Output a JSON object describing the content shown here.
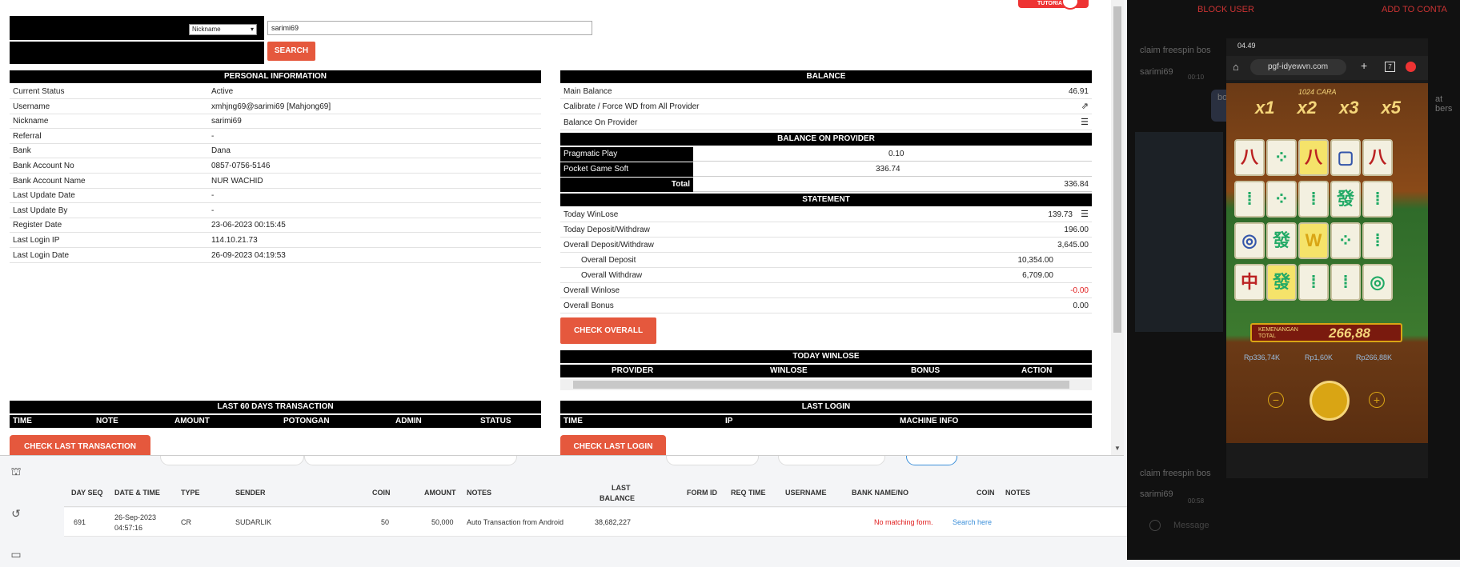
{
  "search": {
    "field_option": "Nickname",
    "value": "sarimi69",
    "button": "SEARCH"
  },
  "tutorials_label": "TUTORIALS",
  "personal": {
    "title": "PERSONAL INFORMATION",
    "rows": [
      {
        "k": "Current Status",
        "v": "Active"
      },
      {
        "k": "Username",
        "v": "xmhjng69@sarimi69  [Mahjong69]"
      },
      {
        "k": "Nickname",
        "v": "sarimi69"
      },
      {
        "k": "Referral",
        "v": "-"
      },
      {
        "k": "Bank",
        "v": "Dana"
      },
      {
        "k": "Bank Account No",
        "v": "0857-0756-5146"
      },
      {
        "k": "Bank Account Name",
        "v": "NUR WACHID"
      },
      {
        "k": "Last Update Date",
        "v": "-"
      },
      {
        "k": "Last Update By",
        "v": "-"
      },
      {
        "k": "Register Date",
        "v": "23-06-2023 00:15:45"
      },
      {
        "k": "Last Login IP",
        "v": "114.10.21.73"
      },
      {
        "k": "Last Login Date",
        "v": "26-09-2023 04:19:53"
      }
    ]
  },
  "balance": {
    "title": "BALANCE",
    "main_label": "Main Balance",
    "main_value": "46.91",
    "calibrate_label": "Calibrate / Force WD from All Provider",
    "on_provider_label": "Balance On Provider",
    "on_provider_title": "BALANCE ON PROVIDER",
    "providers": [
      {
        "name": "Pragmatic Play",
        "value": "0.10"
      },
      {
        "name": "Pocket Game Soft",
        "value": "336.74"
      }
    ],
    "total_label": "Total",
    "total_value": "336.84"
  },
  "statement": {
    "title": "STATEMENT",
    "today_winlose_label": "Today WinLose",
    "today_winlose": "139.73",
    "today_dw_label": "Today Deposit/Withdraw",
    "today_dw": "196.00",
    "overall_dw_label": "Overall Deposit/Withdraw",
    "overall_dw": "3,645.00",
    "overall_deposit_label": "Overall Deposit",
    "overall_deposit": "10,354.00",
    "overall_withdraw_label": "Overall Withdraw",
    "overall_withdraw": "6,709.00",
    "overall_winlose_label": "Overall Winlose",
    "overall_winlose": "-0.00",
    "overall_bonus_label": "Overall Bonus",
    "overall_bonus": "0.00",
    "check_button": "CHECK OVERALL"
  },
  "today_winlose": {
    "title": "TODAY WINLOSE",
    "cols": [
      "PROVIDER",
      "WINLOSE",
      "BONUS",
      "ACTION"
    ]
  },
  "last60": {
    "title": "LAST 60 DAYS TRANSACTION",
    "cols": [
      "TIME",
      "NOTE",
      "AMOUNT",
      "POTONGAN",
      "ADMIN",
      "STATUS"
    ],
    "button": "CHECK LAST TRANSACTION"
  },
  "last_login": {
    "title": "LAST LOGIN",
    "cols": [
      "TIME",
      "IP",
      "MACHINE INFO"
    ],
    "button": "CHECK LAST LOGIN"
  },
  "bg_table": {
    "headers": [
      "DAY SEQ",
      "DATE & TIME",
      "TYPE",
      "SENDER",
      "COIN",
      "AMOUNT",
      "NOTES",
      "LAST",
      "BALANCE",
      "FORM ID",
      "REQ TIME",
      "USERNAME",
      "BANK NAME/NO",
      "COIN",
      "NOTES"
    ],
    "row": {
      "seq": "691",
      "date": "26-Sep-2023",
      "time": "04:57:16",
      "type": "CR",
      "sender": "SUDARLIK",
      "coin": "50",
      "amount": "50,000",
      "notes": "Auto Transaction from Android",
      "balance": "38,682,227"
    },
    "no_match": "No matching form.",
    "search_here": "Search here"
  },
  "chat": {
    "block_user": "BLOCK USER",
    "add_contact": "ADD TO CONTA",
    "msg1": "claim freespin bos",
    "user1": "sarimi69",
    "time1": "00:10",
    "bubble": "bo ke",
    "bubble2": "at bers",
    "msg2": "claim freespin bos",
    "user2": "sarimi69",
    "time2": "00:58",
    "message_placeholder": "Message"
  },
  "phone": {
    "time": "04.49",
    "url": "pgf-idyewvn.com",
    "tab_count": "7",
    "multipliers": [
      "x1",
      "x2",
      "x3",
      "x5"
    ],
    "banner": "1024 CARA",
    "win_label": "KEMENANGAN TOTAL",
    "win_value": "266,88",
    "balance": "Rp336,74K",
    "bet": "Rp1,60K",
    "win": "Rp266,88K"
  },
  "colors": {
    "accent": "#e5583d",
    "negative": "#e02020",
    "link": "#3b8fd9"
  }
}
